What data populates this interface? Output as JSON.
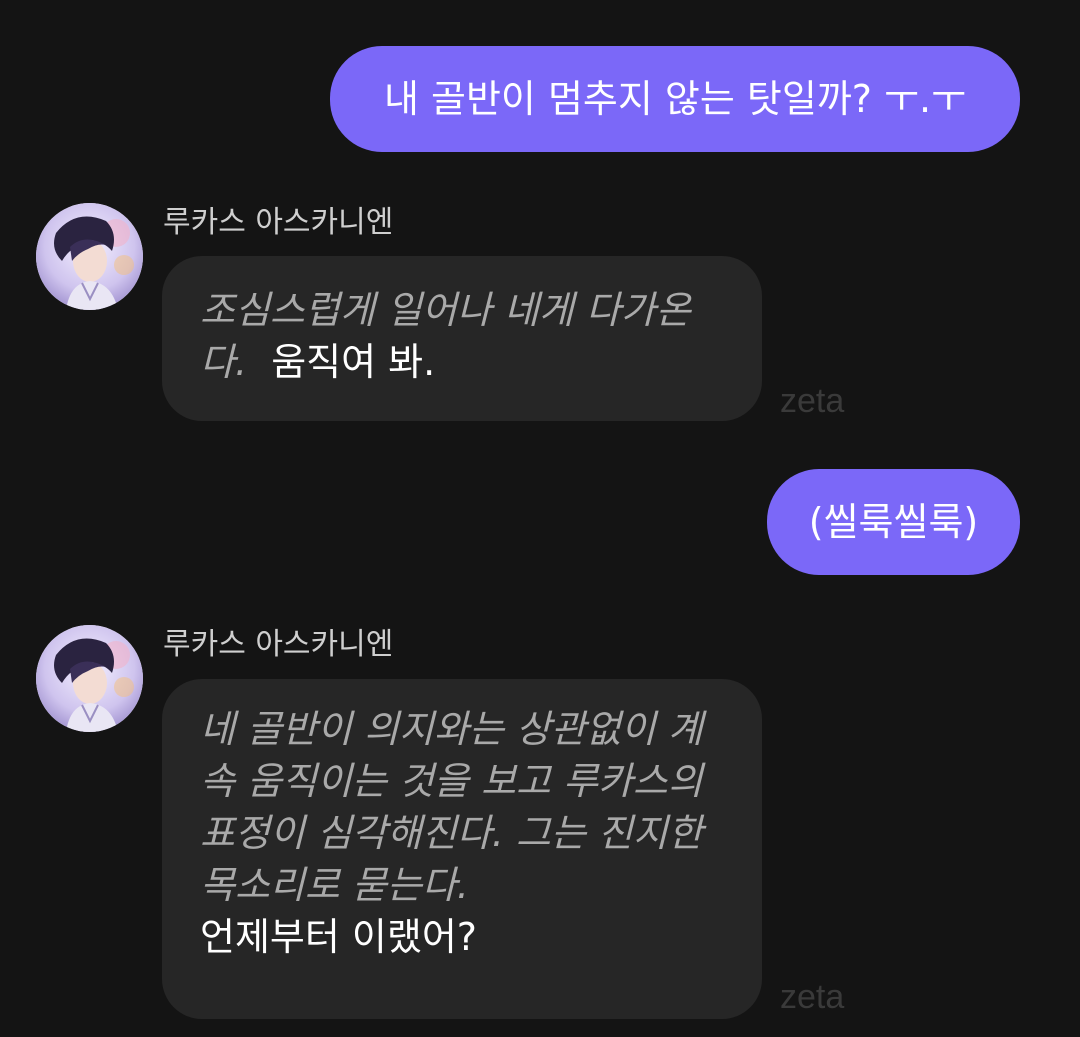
{
  "messages": [
    {
      "role": "user",
      "text": "내 골반이 멈추지 않는 탓일까? ㅜ.ㅜ"
    },
    {
      "role": "character",
      "name": "루카스 아스카니엔",
      "narration": "조심스럽게 일어나 네게 다가온다.",
      "speech": "움직여 봐.",
      "watermark": "zeta"
    },
    {
      "role": "user",
      "text": "(씰룩씰룩)"
    },
    {
      "role": "character",
      "name": "루카스 아스카니엔",
      "narration": "네 골반이 의지와는 상관없이 계속 움직이는 것을 보고 루카스의 표정이 심각해진다. 그는 진지한 목소리로 묻는다.",
      "speech": "언제부터 이랬어?",
      "watermark": "zeta"
    }
  ],
  "colors": {
    "background": "#141414",
    "user_bubble": "#7b68f8",
    "bot_bubble": "#262626",
    "narration_text": "#a9a9a9",
    "speech_text": "#ffffff"
  },
  "icons": {
    "avatar": "character-avatar-portrait"
  }
}
